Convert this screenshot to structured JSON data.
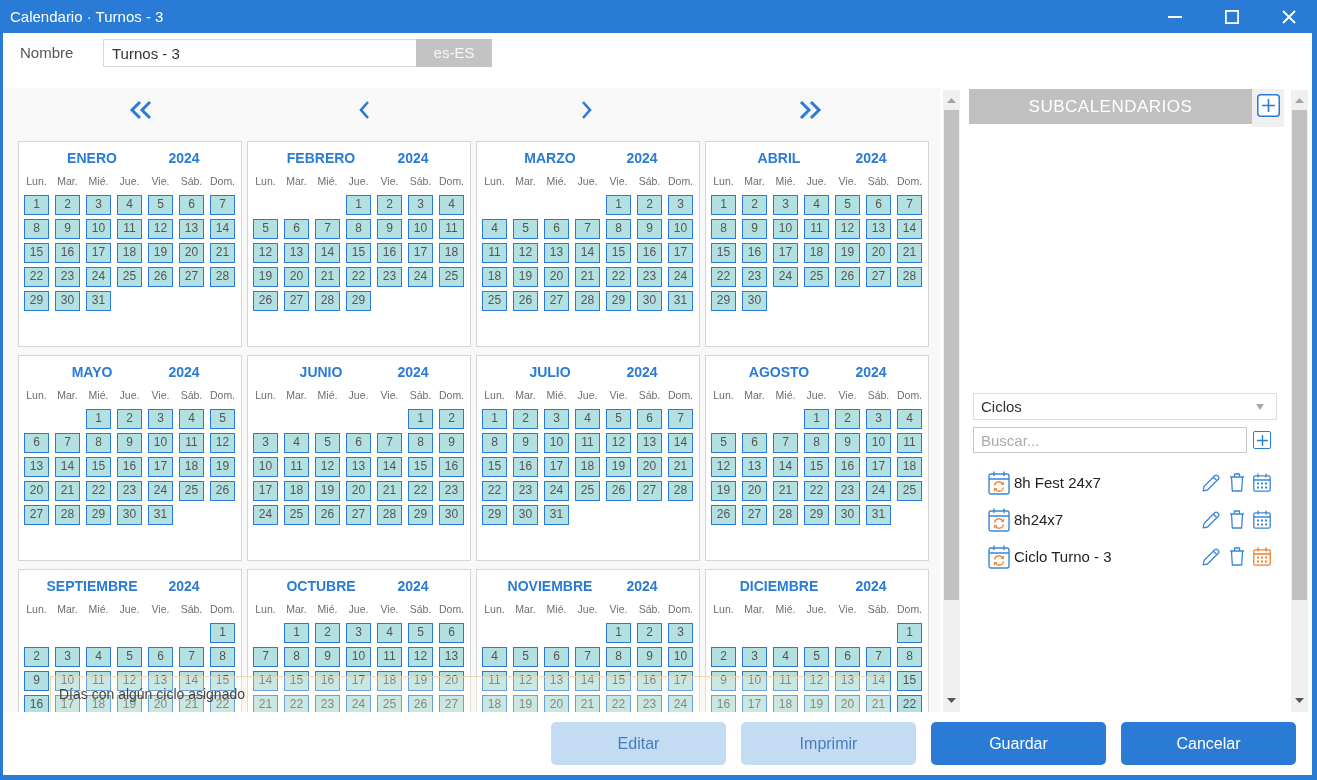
{
  "window": {
    "title": "Calendario · Turnos - 3"
  },
  "name_field": {
    "label": "Nombre",
    "value": "Turnos - 3",
    "locale": "es-ES"
  },
  "calendar": {
    "months": [
      {
        "name": "ENERO",
        "year": "2024",
        "weekdays": [
          "Lun.",
          "Mar.",
          "Mié.",
          "Jue.",
          "Vie.",
          "Sáb.",
          "Dom."
        ],
        "days_with_cycle": true,
        "weeks": [
          {
            "lu": "1",
            "ma": "2",
            "mi": "3",
            "ju": "4",
            "vi": "5",
            "sa": "6",
            "do": "7"
          },
          {
            "lu": "8",
            "ma": "9",
            "mi": "10",
            "ju": "11",
            "vi": "12",
            "sa": "13",
            "do": "14"
          },
          {
            "lu": "15",
            "ma": "16",
            "mi": "17",
            "ju": "18",
            "vi": "19",
            "sa": "20",
            "do": "21"
          },
          {
            "lu": "22",
            "ma": "23",
            "mi": "24",
            "ju": "25",
            "vi": "26",
            "sa": "27",
            "do": "28"
          },
          {
            "lu": "29",
            "ma": "30",
            "mi": "31"
          }
        ]
      },
      {
        "name": "FEBRERO",
        "year": "2024",
        "weekdays": [
          "Lun.",
          "Mar.",
          "Mié.",
          "Jue.",
          "Vie.",
          "Sáb.",
          "Dom."
        ],
        "days_with_cycle": true,
        "weeks": [
          {
            "ju": "1",
            "vi": "2",
            "sa": "3",
            "do": "4"
          },
          {
            "lu": "5",
            "ma": "6",
            "mi": "7",
            "ju": "8",
            "vi": "9",
            "sa": "10",
            "do": "11"
          },
          {
            "lu": "12",
            "ma": "13",
            "mi": "14",
            "ju": "15",
            "vi": "16",
            "sa": "17",
            "do": "18"
          },
          {
            "lu": "19",
            "ma": "20",
            "mi": "21",
            "ju": "22",
            "vi": "23",
            "sa": "24",
            "do": "25"
          },
          {
            "lu": "26",
            "ma": "27",
            "mi": "28",
            "ju": "29"
          }
        ]
      },
      {
        "name": "MARZO",
        "year": "2024",
        "weekdays": [
          "Lun.",
          "Mar.",
          "Mié.",
          "Jue.",
          "Vie.",
          "Sáb.",
          "Dom."
        ],
        "days_with_cycle": true,
        "weeks": [
          {
            "vi": "1",
            "sa": "2",
            "do": "3"
          },
          {
            "lu": "4",
            "ma": "5",
            "mi": "6",
            "ju": "7",
            "vi": "8",
            "sa": "9",
            "do": "10"
          },
          {
            "lu": "11",
            "ma": "12",
            "mi": "13",
            "ju": "14",
            "vi": "15",
            "sa": "16",
            "do": "17"
          },
          {
            "lu": "18",
            "ma": "19",
            "mi": "20",
            "ju": "21",
            "vi": "22",
            "sa": "23",
            "do": "24"
          },
          {
            "lu": "25",
            "ma": "26",
            "mi": "27",
            "ju": "28",
            "vi": "29",
            "sa": "30",
            "do": "31"
          }
        ]
      },
      {
        "name": "ABRIL",
        "year": "2024",
        "weekdays": [
          "Lun.",
          "Mar.",
          "Mié.",
          "Jue.",
          "Vie.",
          "Sáb.",
          "Dom."
        ],
        "days_with_cycle": true,
        "weeks": [
          {
            "lu": "1",
            "ma": "2",
            "mi": "3",
            "ju": "4",
            "vi": "5",
            "sa": "6",
            "do": "7"
          },
          {
            "lu": "8",
            "ma": "9",
            "mi": "10",
            "ju": "11",
            "vi": "12",
            "sa": "13",
            "do": "14"
          },
          {
            "lu": "15",
            "ma": "16",
            "mi": "17",
            "ju": "18",
            "vi": "19",
            "sa": "20",
            "do": "21"
          },
          {
            "lu": "22",
            "ma": "23",
            "mi": "24",
            "ju": "25",
            "vi": "26",
            "sa": "27",
            "do": "28"
          },
          {
            "lu": "29",
            "ma": "30"
          }
        ]
      },
      {
        "name": "MAYO",
        "year": "2024",
        "weekdays": [
          "Lun.",
          "Mar.",
          "Mié.",
          "Jue.",
          "Vie.",
          "Sáb.",
          "Dom."
        ],
        "days_with_cycle": true,
        "weeks": [
          {
            "mi": "1",
            "ju": "2",
            "vi": "3",
            "sa": "4",
            "do": "5"
          },
          {
            "lu": "6",
            "ma": "7",
            "mi": "8",
            "ju": "9",
            "vi": "10",
            "sa": "11",
            "do": "12"
          },
          {
            "lu": "13",
            "ma": "14",
            "mi": "15",
            "ju": "16",
            "vi": "17",
            "sa": "18",
            "do": "19"
          },
          {
            "lu": "20",
            "ma": "21",
            "mi": "22",
            "ju": "23",
            "vi": "24",
            "sa": "25",
            "do": "26"
          },
          {
            "lu": "27",
            "ma": "28",
            "mi": "29",
            "ju": "30",
            "vi": "31"
          }
        ]
      },
      {
        "name": "JUNIO",
        "year": "2024",
        "weekdays": [
          "Lun.",
          "Mar.",
          "Mié.",
          "Jue.",
          "Vie.",
          "Sáb.",
          "Dom."
        ],
        "days_with_cycle": true,
        "weeks": [
          {
            "sa": "1",
            "do": "2"
          },
          {
            "lu": "3",
            "ma": "4",
            "mi": "5",
            "ju": "6",
            "vi": "7",
            "sa": "8",
            "do": "9"
          },
          {
            "lu": "10",
            "ma": "11",
            "mi": "12",
            "ju": "13",
            "vi": "14",
            "sa": "15",
            "do": "16"
          },
          {
            "lu": "17",
            "ma": "18",
            "mi": "19",
            "ju": "20",
            "vi": "21",
            "sa": "22",
            "do": "23"
          },
          {
            "lu": "24",
            "ma": "25",
            "mi": "26",
            "ju": "27",
            "vi": "28",
            "sa": "29",
            "do": "30"
          }
        ]
      },
      {
        "name": "JULIO",
        "year": "2024",
        "weekdays": [
          "Lun.",
          "Mar.",
          "Mié.",
          "Jue.",
          "Vie.",
          "Sáb.",
          "Dom."
        ],
        "days_with_cycle": true,
        "weeks": [
          {
            "lu": "1",
            "ma": "2",
            "mi": "3",
            "ju": "4",
            "vi": "5",
            "sa": "6",
            "do": "7"
          },
          {
            "lu": "8",
            "ma": "9",
            "mi": "10",
            "ju": "11",
            "vi": "12",
            "sa": "13",
            "do": "14"
          },
          {
            "lu": "15",
            "ma": "16",
            "mi": "17",
            "ju": "18",
            "vi": "19",
            "sa": "20",
            "do": "21"
          },
          {
            "lu": "22",
            "ma": "23",
            "mi": "24",
            "ju": "25",
            "vi": "26",
            "sa": "27",
            "do": "28"
          },
          {
            "lu": "29",
            "ma": "30",
            "mi": "31"
          }
        ]
      },
      {
        "name": "AGOSTO",
        "year": "2024",
        "weekdays": [
          "Lun.",
          "Mar.",
          "Mié.",
          "Jue.",
          "Vie.",
          "Sáb.",
          "Dom."
        ],
        "days_with_cycle": true,
        "weeks": [
          {
            "ju": "1",
            "vi": "2",
            "sa": "3",
            "do": "4"
          },
          {
            "lu": "5",
            "ma": "6",
            "mi": "7",
            "ju": "8",
            "vi": "9",
            "sa": "10",
            "do": "11"
          },
          {
            "lu": "12",
            "ma": "13",
            "mi": "14",
            "ju": "15",
            "vi": "16",
            "sa": "17",
            "do": "18"
          },
          {
            "lu": "19",
            "ma": "20",
            "mi": "21",
            "ju": "22",
            "vi": "23",
            "sa": "24",
            "do": "25"
          },
          {
            "lu": "26",
            "ma": "27",
            "mi": "28",
            "ju": "29",
            "vi": "30",
            "sa": "31"
          }
        ]
      },
      {
        "name": "SEPTIEMBRE",
        "year": "2024",
        "weekdays": [
          "Lun.",
          "Mar.",
          "Mié.",
          "Jue.",
          "Vie.",
          "Sáb.",
          "Dom."
        ],
        "days_with_cycle": true,
        "weeks": [
          {
            "do": "1"
          },
          {
            "lu": "2",
            "ma": "3",
            "mi": "4",
            "ju": "5",
            "vi": "6",
            "sa": "7",
            "do": "8"
          },
          {
            "lu": "9",
            "ma": "10",
            "mi": "11",
            "ju": "12",
            "vi": "13",
            "sa": "14",
            "do": "15"
          },
          {
            "lu": "16",
            "ma": "17",
            "mi": "18",
            "ju": "19",
            "vi": "20",
            "sa": "21",
            "do": "22"
          }
        ]
      },
      {
        "name": "OCTUBRE",
        "year": "2024",
        "weekdays": [
          "Lun.",
          "Mar.",
          "Mié.",
          "Jue.",
          "Vie.",
          "Sáb.",
          "Dom."
        ],
        "days_with_cycle": true,
        "weeks": [
          {
            "ma": "1",
            "mi": "2",
            "ju": "3",
            "vi": "4",
            "sa": "5",
            "do": "6"
          },
          {
            "lu": "7",
            "ma": "8",
            "mi": "9",
            "ju": "10",
            "vi": "11",
            "sa": "12",
            "do": "13"
          },
          {
            "lu": "14",
            "ma": "15",
            "mi": "16",
            "ju": "17",
            "vi": "18",
            "sa": "19",
            "do": "20"
          },
          {
            "lu": "21",
            "ma": "22",
            "mi": "23",
            "ju": "24",
            "vi": "25",
            "sa": "26",
            "do": "27"
          }
        ]
      },
      {
        "name": "NOVIEMBRE",
        "year": "2024",
        "weekdays": [
          "Lun.",
          "Mar.",
          "Mié.",
          "Jue.",
          "Vie.",
          "Sáb.",
          "Dom."
        ],
        "days_with_cycle": true,
        "weeks": [
          {
            "vi": "1",
            "sa": "2",
            "do": "3"
          },
          {
            "lu": "4",
            "ma": "5",
            "mi": "6",
            "ju": "7",
            "vi": "8",
            "sa": "9",
            "do": "10"
          },
          {
            "lu": "11",
            "ma": "12",
            "mi": "13",
            "ju": "14",
            "vi": "15",
            "sa": "16",
            "do": "17"
          },
          {
            "lu": "18",
            "ma": "19",
            "mi": "20",
            "ju": "21",
            "vi": "22",
            "sa": "23",
            "do": "24"
          }
        ]
      },
      {
        "name": "DICIEMBRE",
        "year": "2024",
        "weekdays": [
          "Lun.",
          "Mar.",
          "Mié.",
          "Jue.",
          "Vie.",
          "Sáb.",
          "Dom."
        ],
        "days_with_cycle": true,
        "weeks": [
          {
            "do": "1"
          },
          {
            "lu": "2",
            "ma": "3",
            "mi": "4",
            "ju": "5",
            "vi": "6",
            "sa": "7",
            "do": "8"
          },
          {
            "lu": "9",
            "ma": "10",
            "mi": "11",
            "ju": "12",
            "vi": "13",
            "sa": "14",
            "do": "15"
          },
          {
            "lu": "16",
            "ma": "17",
            "mi": "18",
            "ju": "19",
            "vi": "20",
            "sa": "21",
            "do": "22"
          }
        ]
      }
    ],
    "tooltip": "Días con algún ciclo asignado"
  },
  "subcalendars": {
    "title": "SUBCALENDARIOS",
    "filter": "Ciclos",
    "search": {
      "placeholder": "Buscar..."
    },
    "items": [
      {
        "name": "8h Fest 24x7",
        "selected": false
      },
      {
        "name": "8h24x7",
        "selected": false
      },
      {
        "name": "Ciclo Turno - 3",
        "selected": true
      }
    ]
  },
  "buttons": [
    {
      "label": "Editar",
      "disabled": true
    },
    {
      "label": "Imprimir",
      "disabled": true
    },
    {
      "label": "Guardar",
      "disabled": false
    },
    {
      "label": "Cancelar",
      "disabled": false
    }
  ]
}
